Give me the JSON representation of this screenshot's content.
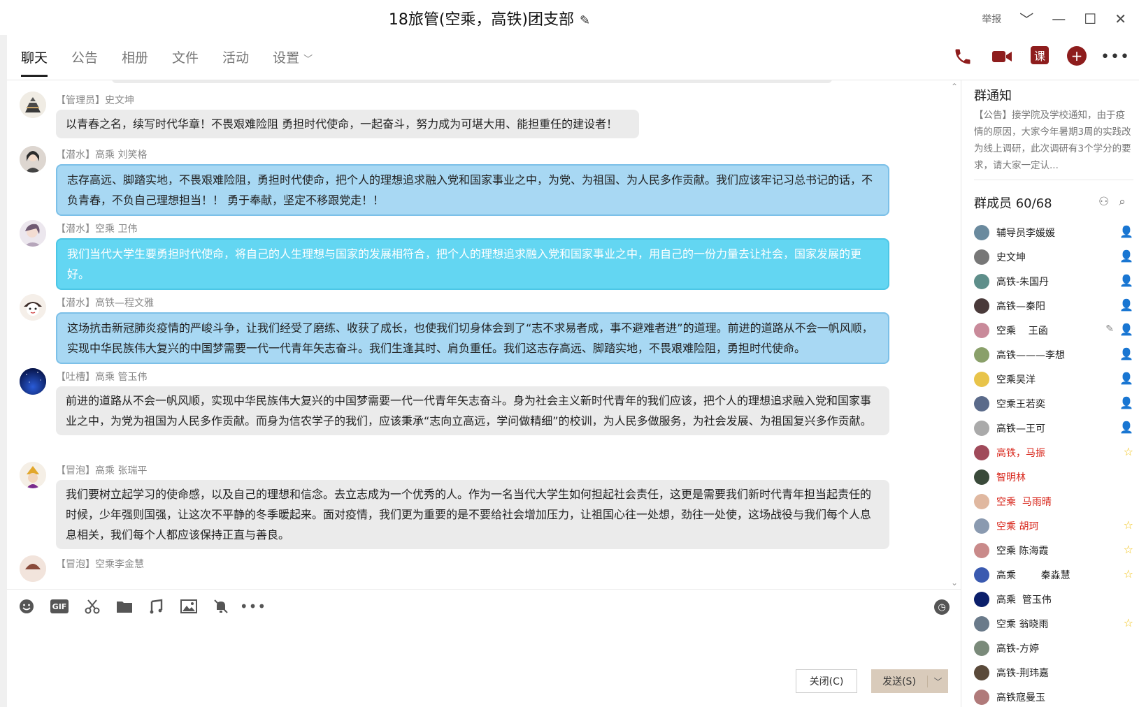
{
  "window": {
    "title": "18旅管(空乘，高铁)团支部",
    "report_label": "举报",
    "controls": [
      "﹀",
      "—",
      "☐",
      "✕"
    ]
  },
  "tabs": [
    {
      "label": "聊天",
      "active": true
    },
    {
      "label": "公告"
    },
    {
      "label": "相册"
    },
    {
      "label": "文件"
    },
    {
      "label": "活动"
    },
    {
      "label": "设置"
    }
  ],
  "toolbar_icons": [
    "phone-icon",
    "video-call-icon",
    "lesson-icon",
    "add-icon",
    "more-icon"
  ],
  "toolbar_lesson_label": "课",
  "messages": [
    {
      "sender": "【管理员】史文坤",
      "text": "以青春之名，续写时代华章！不畏艰难险阻 勇担时代使命，一起奋斗，努力成为可堪大用、能担重任的建设者！",
      "style": "gray"
    },
    {
      "sender": "【潜水】高乘 刘笑格",
      "text": "志存高远、脚踏实地，不畏艰难险阻，勇担时代使命，把个人的理想追求融入党和国家事业之中，为党、为祖国、为人民多作贡献。我们应该牢记习总书记的话，不负青春，不负自己理想担当！！ 勇于奉献，坚定不移跟党走！！",
      "style": "blue"
    },
    {
      "sender": "【潜水】空乘 卫伟",
      "text": "我们当代大学生要勇担时代使命，将自己的人生理想与国家的发展相符合，把个人的理想追求融入党和国家事业之中，用自己的一份力量去让社会，国家发展的更好。",
      "style": "cyan"
    },
    {
      "sender": "【潜水】高铁—程文雅",
      "text": "这场抗击新冠肺炎疫情的严峻斗争，让我们经受了磨练、收获了成长，也使我们切身体会到了“志不求易者成，事不避难者进”的道理。前进的道路从不会一帆风顺，实现中华民族伟大复兴的中国梦需要一代一代青年矢志奋斗。我们生逢其时、肩负重任。我们这志存高远、脚踏实地，不畏艰难险阻，勇担时代使命。",
      "style": "blue"
    },
    {
      "sender": "【吐槽】高乘  管玉伟",
      "text": "前进的道路从不会一帆风顺，实现中华民族伟大复兴的中国梦需要一代一代青年矢志奋斗。身为社会主义新时代青年的我们应该，把个人的理想追求融入党和国家事业之中，为党为祖国为人民多作贡献。而身为信农学子的我们，应该秉承“志向立高远，学问做精细”的校训，为人民多做服务，为社会发展、为祖国复兴多作贡献。",
      "style": "gray"
    },
    {
      "sender": "【冒泡】高乘  张瑞平",
      "text": "我们要树立起学习的使命感，以及自己的理想和信念。去立志成为一个优秀的人。作为一名当代大学生如何担起社会责任，这更是需要我们新时代青年担当起责任的时候，少年强则国强，让这次不平静的冬季暖起来。面对疫情，我们更为重要的是不要给社会增加压力，让祖国心往一处想，劲往一处使，这场战役与我们每个人息息相关，我们每个人都应该保持正直与善良。",
      "style": "gray"
    },
    {
      "sender": "【冒泡】空乘李金慧",
      "text": "",
      "style": "none"
    }
  ],
  "input": {
    "tools": [
      "emoji-icon",
      "gif-icon",
      "scissors-icon",
      "folder-icon",
      "music-icon",
      "image-icon",
      "mute-icon",
      "more-icon"
    ],
    "gif_label": "GIF",
    "close_label": "关闭(C)",
    "send_label": "发送(S)"
  },
  "notice": {
    "title": "群通知",
    "body": "【公告】接学院及学校通知，由于疫情的原因，大家今年暑期3周的实践改为线上调研，此次调研有3个学分的要求，请大家一定认..."
  },
  "members": {
    "title": "群成员 60/68",
    "list": [
      {
        "name": "辅导员李媛媛",
        "role": "admin",
        "red": false
      },
      {
        "name": "史文坤",
        "role": "admin",
        "red": false
      },
      {
        "name": "高铁-朱国丹",
        "role": "admin",
        "red": false
      },
      {
        "name": "高铁—秦阳",
        "role": "admin",
        "red": false
      },
      {
        "name": "空乘    王函",
        "role": "admin",
        "red": false,
        "pen": true
      },
      {
        "name": "高铁———李想",
        "role": "admin",
        "red": false
      },
      {
        "name": "空乘吴洋",
        "role": "admin",
        "red": false
      },
      {
        "name": "空乘王若奕",
        "role": "admin",
        "red": false
      },
      {
        "name": "高铁—王可",
        "role": "admin",
        "red": false
      },
      {
        "name": "高铁，马振",
        "role": "star",
        "red": true
      },
      {
        "name": "智明林",
        "role": "",
        "red": true
      },
      {
        "name": "空乘  马雨晴",
        "role": "",
        "red": true
      },
      {
        "name": "空乘 胡珂",
        "role": "star",
        "red": true
      },
      {
        "name": "空乘 陈海霞",
        "role": "star",
        "red": false
      },
      {
        "name": "高乘        秦淼慧",
        "role": "star",
        "red": false
      },
      {
        "name": "高乘  管玉伟",
        "role": "",
        "red": false
      },
      {
        "name": "空乘 翁晓雨",
        "role": "star",
        "red": false
      },
      {
        "name": "高铁-方婷",
        "role": "",
        "red": false
      },
      {
        "name": "高铁-荆玮嘉",
        "role": "",
        "red": false
      },
      {
        "name": "高铁寇曼玉",
        "role": "",
        "red": false
      }
    ]
  }
}
